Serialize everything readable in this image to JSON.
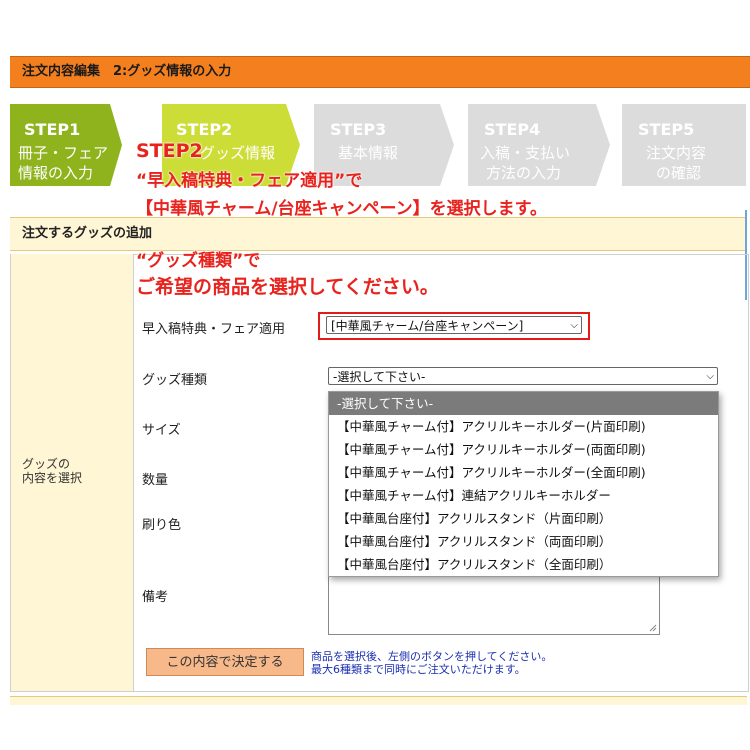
{
  "header": {
    "title": "注文内容編集　2:グッズ情報の入力"
  },
  "steps": [
    {
      "title": "STEP1",
      "line1": "冊子・フェア",
      "line2": "情報の入力",
      "color": "#8fb31c"
    },
    {
      "title": "STEP2",
      "line1": "グッズ情報",
      "line2": "",
      "color": "#cddd38"
    },
    {
      "title": "STEP3",
      "line1": "基本情報",
      "line2": "",
      "color": "#dcdcdc"
    },
    {
      "title": "STEP4",
      "line1": "入稿・支払い",
      "line2": "方法の入力",
      "color": "#dcdcdc"
    },
    {
      "title": "STEP5",
      "line1": "注文内容",
      "line2": "の確認",
      "color": "#dcdcdc"
    }
  ],
  "callout1": {
    "line1": "STEP2",
    "line2": "“早入稿特典・フェア適用”で",
    "line3": "【中華風チャーム/台座キャンペーン】を選択します。"
  },
  "section": {
    "title": "注文するグッズの追加"
  },
  "callout2": {
    "line1": "“グッズ種類”で",
    "line2": "ご希望の商品を選択してください。"
  },
  "form": {
    "left_label_1": "グッズの",
    "left_label_2": "内容を選択",
    "fair_label": "早入稿特典・フェア適用",
    "fair_value": "[中華風チャーム/台座キャンペーン]",
    "goods_label": "グッズ種類",
    "goods_value": "-選択して下さい-",
    "size_label": "サイズ",
    "qty_label": "数量",
    "color_label": "刷り色",
    "remarks_label": "備考",
    "submit_label": "この内容で決定する",
    "note_line1": "商品を選択後、左側のボタンを押してください。",
    "note_line2": "最大6種類まで同時にご注文いただけます。"
  },
  "dropdown_options": [
    "-選択して下さい-",
    "【中華風チャーム付】アクリルキーホルダー(片面印刷)",
    "【中華風チャーム付】アクリルキーホルダー(両面印刷)",
    "【中華風チャーム付】アクリルキーホルダー(全面印刷)",
    "【中華風チャーム付】連結アクリルキーホルダー",
    "【中華風台座付】アクリルスタンド（片面印刷）",
    "【中華風台座付】アクリルスタンド（両面印刷）",
    "【中華風台座付】アクリルスタンド（全面印刷）"
  ],
  "colors": {
    "accent": "#f47f1f",
    "callout": "#e8231e",
    "highlight_border": "#e21b1b"
  }
}
